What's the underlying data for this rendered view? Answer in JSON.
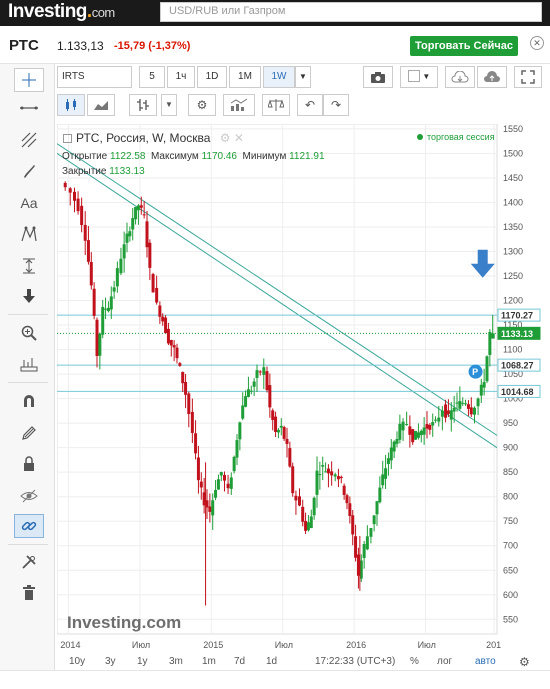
{
  "site": {
    "logo_main": "Investing",
    "logo_suffix": "com",
    "search_placeholder": "USD/RUB или Газпром"
  },
  "quote": {
    "symbol": "РТС",
    "price": "1.133,13",
    "change": "-15,79 (-1,37%)",
    "trade_button": "Торговать Сейчас"
  },
  "toolbar": {
    "symbol_input": "IRTS",
    "intervals": [
      "5",
      "1ч",
      "1D",
      "1M",
      "1W"
    ],
    "selected_interval": "1W"
  },
  "legend": {
    "title": "РТС, Россия, W, Москва",
    "session": "торговая сессия",
    "open_label": "Открытие",
    "open": "1122.58",
    "high_label": "Максимум",
    "high": "1170.46",
    "low_label": "Минимум",
    "low": "1121.91",
    "close_label": "Закрытие",
    "close": "1133.13"
  },
  "watermark": "Investing.com",
  "bottom": {
    "ranges": [
      "10y",
      "3y",
      "1y",
      "3m",
      "1m",
      "7d",
      "1d"
    ],
    "time": "17:22:33 (UTC+3)",
    "percent": "%",
    "log": "лог",
    "auto": "авто"
  },
  "colors": {
    "up": "#1f9e38",
    "down": "#c1111c",
    "trend": "#3aa89a",
    "level": "#76c8d6",
    "accent": "#2a6cb5"
  },
  "chart_data": {
    "type": "candlestick",
    "title": "РТС, Россия, W, Москва",
    "ylim": [
      520,
      1560
    ],
    "y_ticks": [
      550,
      600,
      650,
      700,
      750,
      800,
      850,
      900,
      950,
      1000,
      1050,
      1100,
      1150,
      1200,
      1250,
      1300,
      1350,
      1400,
      1450,
      1500,
      1550
    ],
    "x_ticks": [
      "2014",
      "Июл",
      "2015",
      "Июл",
      "2016",
      "Июл",
      "201"
    ],
    "price_labels": [
      {
        "value": 1170.27,
        "text": "1170.27",
        "kind": "level"
      },
      {
        "value": 1133.13,
        "text": "1133.13",
        "kind": "last"
      },
      {
        "value": 1068.27,
        "text": "1068.27",
        "kind": "level"
      },
      {
        "value": 1014.68,
        "text": "1014.68",
        "kind": "level"
      }
    ],
    "horizontal_levels": [
      1170.27,
      1068.27,
      1014.68
    ],
    "last_price": 1133.13,
    "close_path": [
      [
        2013.96,
        1440
      ],
      [
        2014.03,
        1420
      ],
      [
        2014.08,
        1390
      ],
      [
        2014.13,
        1330
      ],
      [
        2014.17,
        1230
      ],
      [
        2014.21,
        1090
      ],
      [
        2014.25,
        1180
      ],
      [
        2014.29,
        1190
      ],
      [
        2014.33,
        1230
      ],
      [
        2014.38,
        1290
      ],
      [
        2014.42,
        1330
      ],
      [
        2014.46,
        1370
      ],
      [
        2014.5,
        1395
      ],
      [
        2014.54,
        1370
      ],
      [
        2014.58,
        1260
      ],
      [
        2014.63,
        1190
      ],
      [
        2014.67,
        1160
      ],
      [
        2014.71,
        1120
      ],
      [
        2014.75,
        1100
      ],
      [
        2014.79,
        1060
      ],
      [
        2014.83,
        1010
      ],
      [
        2014.88,
        930
      ],
      [
        2014.92,
        830
      ],
      [
        2014.96,
        790
      ],
      [
        2015.0,
        770
      ],
      [
        2015.04,
        820
      ],
      [
        2015.08,
        850
      ],
      [
        2015.13,
        810
      ],
      [
        2015.17,
        880
      ],
      [
        2015.21,
        960
      ],
      [
        2015.25,
        1010
      ],
      [
        2015.29,
        1020
      ],
      [
        2015.33,
        1050
      ],
      [
        2015.38,
        1060
      ],
      [
        2015.42,
        980
      ],
      [
        2015.46,
        930
      ],
      [
        2015.5,
        940
      ],
      [
        2015.54,
        900
      ],
      [
        2015.58,
        810
      ],
      [
        2015.63,
        780
      ],
      [
        2015.67,
        730
      ],
      [
        2015.71,
        760
      ],
      [
        2015.75,
        850
      ],
      [
        2015.79,
        860
      ],
      [
        2015.83,
        850
      ],
      [
        2015.88,
        850
      ],
      [
        2015.92,
        830
      ],
      [
        2015.96,
        790
      ],
      [
        2016.0,
        720
      ],
      [
        2016.04,
        640
      ],
      [
        2016.08,
        700
      ],
      [
        2016.13,
        740
      ],
      [
        2016.17,
        790
      ],
      [
        2016.21,
        840
      ],
      [
        2016.25,
        880
      ],
      [
        2016.29,
        910
      ],
      [
        2016.33,
        940
      ],
      [
        2016.38,
        950
      ],
      [
        2016.42,
        920
      ],
      [
        2016.46,
        930
      ],
      [
        2016.5,
        940
      ],
      [
        2016.54,
        945
      ],
      [
        2016.58,
        950
      ],
      [
        2016.63,
        980
      ],
      [
        2016.67,
        960
      ],
      [
        2016.71,
        985
      ],
      [
        2016.75,
        990
      ],
      [
        2016.79,
        995
      ],
      [
        2016.83,
        975
      ],
      [
        2016.88,
        1000
      ],
      [
        2016.92,
        1040
      ],
      [
        2016.96,
        1133.13
      ]
    ]
  }
}
